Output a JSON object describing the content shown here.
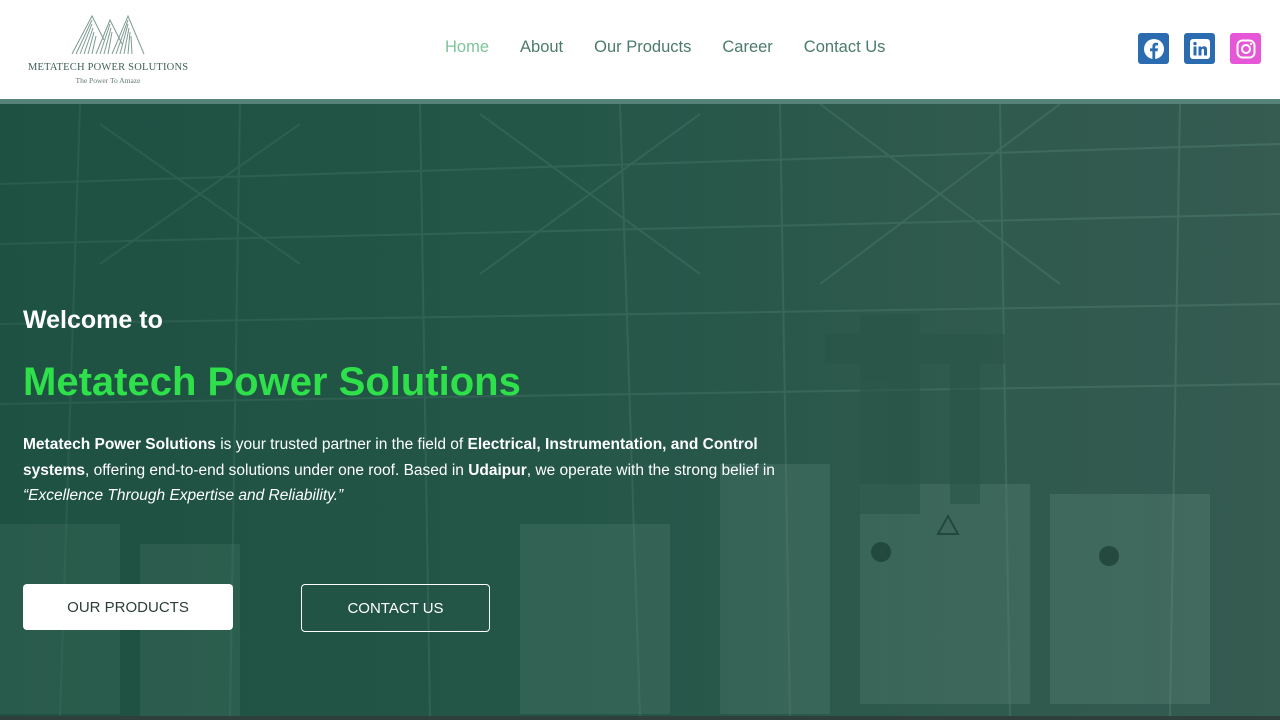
{
  "logo": {
    "name": "METATECH POWER SOLUTIONS",
    "tagline": "The Power To Amaze"
  },
  "nav": {
    "items": [
      "Home",
      "About",
      "Our Products",
      "Career",
      "Contact Us"
    ],
    "active": "Home"
  },
  "social": [
    {
      "name": "facebook-icon",
      "color": "#2b6cb0"
    },
    {
      "name": "linkedin-icon",
      "color": "#2b6cb0"
    },
    {
      "name": "instagram-icon",
      "color": "#e557d6"
    }
  ],
  "hero": {
    "welcome": "Welcome to",
    "title": "Metatech Power Solutions",
    "desc": {
      "company": "Metatech Power Solutions",
      "t1": " is your trusted partner in the field of ",
      "fields": "Electrical, Instrumentation, and Control systems",
      "t2": ", offering end-to-end solutions under one roof. Based in ",
      "city": "Udaipur",
      "t3": ", we operate with the strong belief in ",
      "motto": "“Excellence Through Expertise and Reliability.”"
    },
    "buttons": {
      "products": "OUR PRODUCTS",
      "contact": "CONTACT US"
    }
  },
  "colors": {
    "accent": "#2ee04a",
    "nav_text": "#4c7a6e",
    "nav_active": "#7dc59a",
    "hero_overlay": "#24594a"
  }
}
